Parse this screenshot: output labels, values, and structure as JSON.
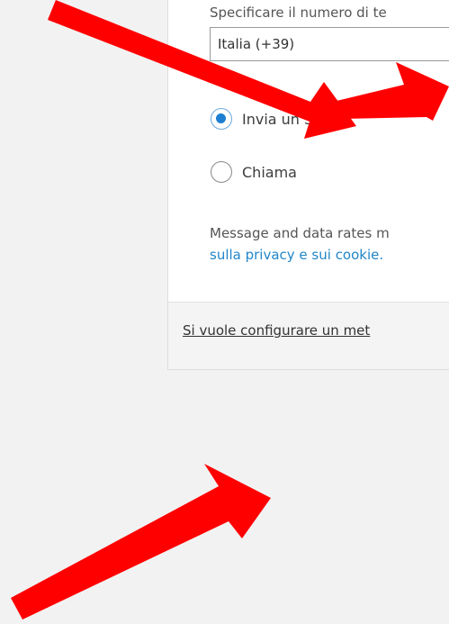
{
  "form": {
    "phone_label": "Specificare il numero di te",
    "country_code_value": "Italia (+39)",
    "options": [
      {
        "label": "Invia un SMS",
        "selected": true
      },
      {
        "label": "Chiama",
        "selected": false
      }
    ],
    "disclaimer": "Message and data rates m",
    "privacy_link": "sulla privacy e sui cookie."
  },
  "footer": {
    "alt_method_link": "Si vuole configurare un met"
  },
  "colors": {
    "accent": "#1e7fd2",
    "link": "#2286c9",
    "annotation_arrow": "#ff0000"
  },
  "annotations": {
    "arrows": [
      "arrow-icon",
      "arrow-icon",
      "arrow-icon"
    ]
  }
}
